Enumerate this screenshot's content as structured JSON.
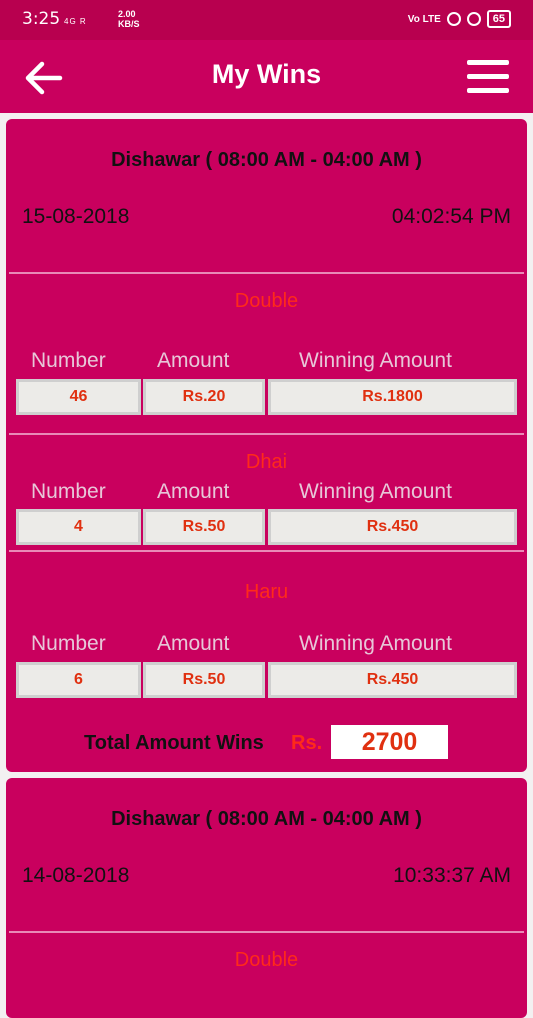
{
  "status_bar": {
    "time": "3:25",
    "network": "4G R",
    "speed_value": "2.00",
    "speed_unit": "KB/S",
    "volte": "Vo LTE",
    "battery": "65"
  },
  "header": {
    "title": "My Wins",
    "back_icon": "arrow-left-icon",
    "menu_icon": "hamburger-menu-icon"
  },
  "colors": {
    "primary": "#c9005e",
    "status_bar": "#b8004f",
    "accent_red": "#ff2a1a",
    "header_text": "#e7c7d8"
  },
  "cards": [
    {
      "title": "Dishawar ( 08:00 AM - 04:00 AM )",
      "date": "15-08-2018",
      "time": "04:02:54 PM",
      "sections": [
        {
          "name": "Double",
          "headers": [
            "Number",
            "Amount",
            "Winning Amount"
          ],
          "row": [
            "46",
            "Rs.20",
            "Rs.1800"
          ]
        },
        {
          "name": "Dhai",
          "headers": [
            "Number",
            "Amount",
            "Winning Amount"
          ],
          "row": [
            "4",
            "Rs.50",
            "Rs.450"
          ]
        },
        {
          "name": "Haru",
          "headers": [
            "Number",
            "Amount",
            "Winning Amount"
          ],
          "row": [
            "6",
            "Rs.50",
            "Rs.450"
          ]
        }
      ],
      "total_label": "Total Amount Wins",
      "total_currency": "Rs.",
      "total_value": "2700"
    },
    {
      "title": "Dishawar ( 08:00 AM - 04:00 AM )",
      "date": "14-08-2018",
      "time": "10:33:37 AM",
      "sections": [
        {
          "name": "Double"
        }
      ]
    }
  ]
}
